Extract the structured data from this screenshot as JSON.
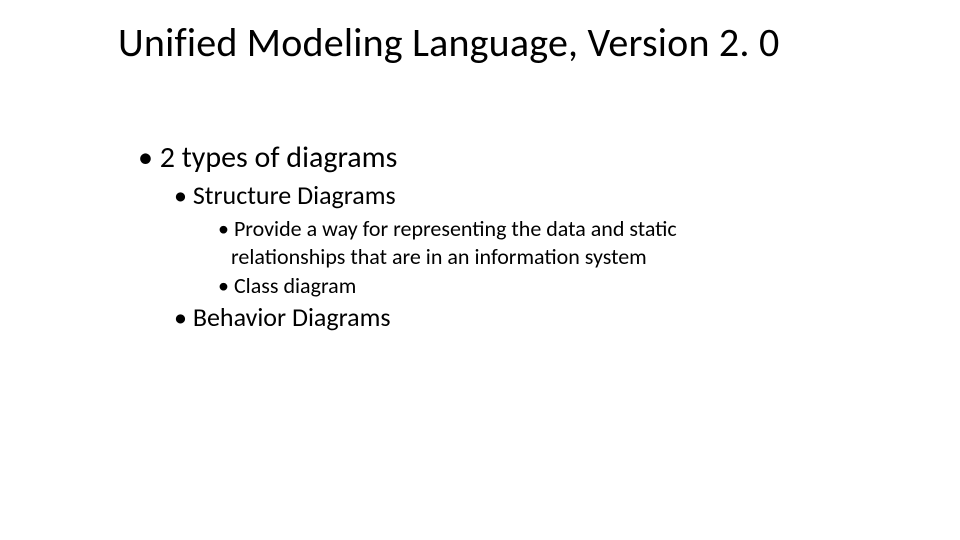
{
  "title": "Unified Modeling Language, Version 2. 0",
  "bullets": {
    "l1_a": "2 types of diagrams",
    "l2_a": "Structure Diagrams",
    "l3_a": "Provide a way for representing the data and static relationships that are in an information system",
    "l3_b": "Class diagram",
    "l2_b": "Behavior Diagrams"
  }
}
